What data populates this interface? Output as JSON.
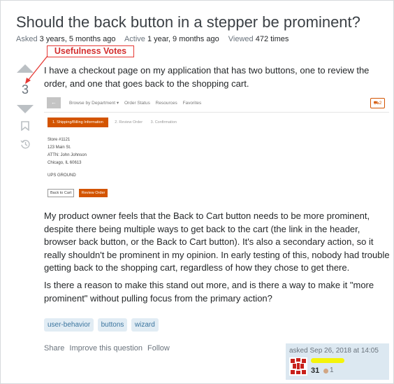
{
  "question": {
    "title": "Should the back button in a stepper be prominent?",
    "meta": {
      "asked_label": "Asked",
      "asked_value": "3 years, 5 months ago",
      "active_label": "Active",
      "active_value": "1 year, 9 months ago",
      "viewed_label": "Viewed",
      "viewed_value": "472 times"
    },
    "vote_count": "3",
    "body_p1": "I have a checkout page on my application that has two buttons, one to review the order, and one that goes back to the shopping cart.",
    "body_p2": "My product owner feels that the Back to Cart button needs to be more prominent, despite there being multiple ways to get back to the cart (the link in the header, browser back button, or the Back to Cart button). It's also a secondary action, so it really shouldn't be prominent in my opinion. In early testing of this, nobody had trouble getting back to the shopping cart, regardless of how they chose to get there.",
    "body_p3": "Is there a reason to make this stand out more, and is there a way to make it \"more prominent\" without pulling focus from the primary action?",
    "tags": [
      "user-behavior",
      "buttons",
      "wizard"
    ],
    "actions": [
      "Share",
      "Improve this question",
      "Follow"
    ],
    "owner": {
      "asked_text": "asked Sep 26, 2018 at 14:05",
      "reputation": "31",
      "bronze_badges": "1"
    }
  },
  "annotation": {
    "label": "Usefulness Votes",
    "color": "#e53935"
  },
  "embedded_screenshot": {
    "back_glyph": "←",
    "nav": [
      "Browse by Department ▾",
      "Order Status",
      "Resources",
      "Favorites"
    ],
    "cart_count": "2",
    "steps": [
      "1. Shipping/Billing Information",
      "2. Review Order",
      "3. Confirmation"
    ],
    "address": [
      "Store #1121",
      "123 Main St.",
      "ATTN: John Johnson",
      "Chicago, IL 60613"
    ],
    "shipping": "UPS GROUND",
    "back_button": "Back to Cart",
    "review_button": "Review Order",
    "accent": "#d35400"
  }
}
